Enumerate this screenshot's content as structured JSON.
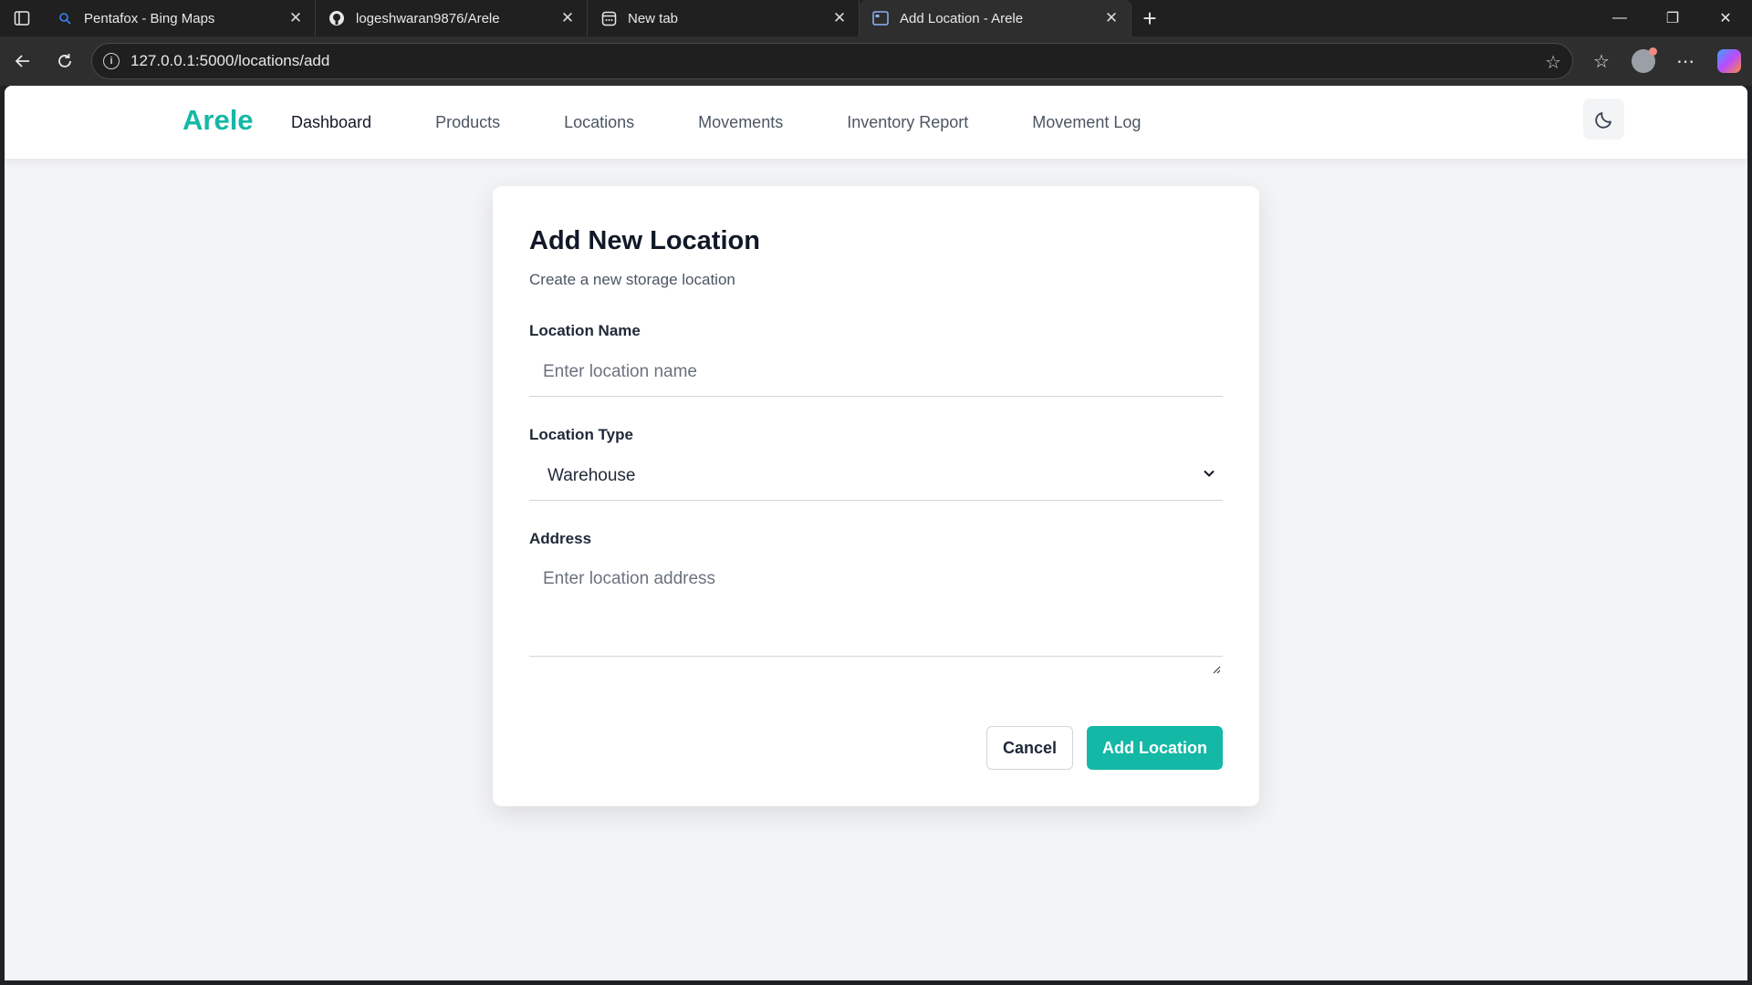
{
  "browser": {
    "tabs": [
      {
        "title": "Pentafox - Bing Maps",
        "icon": "bing-search-icon",
        "active": false
      },
      {
        "title": "logeshwaran9876/Arele",
        "icon": "github-icon",
        "active": false
      },
      {
        "title": "New tab",
        "icon": "newtab-icon",
        "active": false
      },
      {
        "title": "Add Location - Arele",
        "icon": "page-icon",
        "active": true
      }
    ],
    "url": "127.0.0.1:5000/locations/add"
  },
  "app": {
    "brand": "Arele",
    "nav": [
      "Dashboard",
      "Products",
      "Locations",
      "Movements",
      "Inventory Report",
      "Movement Log"
    ],
    "active_nav": "Dashboard",
    "accent_color": "#14b8a6"
  },
  "form": {
    "title": "Add New Location",
    "subtitle": "Create a new storage location",
    "name_label": "Location Name",
    "name_placeholder": "Enter location name",
    "type_label": "Location Type",
    "type_value": "Warehouse",
    "address_label": "Address",
    "address_placeholder": "Enter location address",
    "cancel_label": "Cancel",
    "submit_label": "Add Location"
  }
}
